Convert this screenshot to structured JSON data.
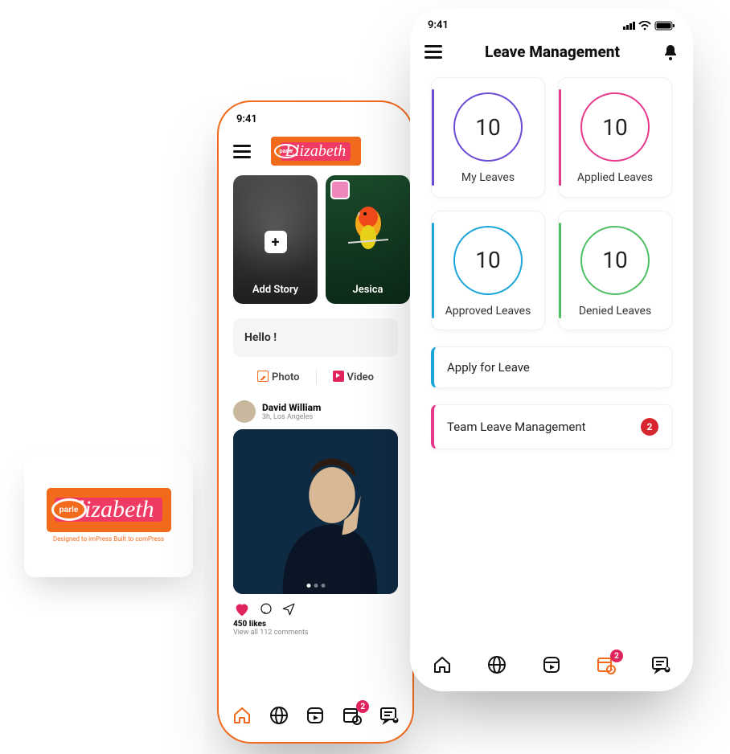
{
  "logo": {
    "brand_oval": "parle",
    "brand_script": "Elizabeth",
    "tagline": "Designed to imPress    Built to comPress"
  },
  "phone1": {
    "status_time": "9:41",
    "topbar": {
      "brand_oval": "parle",
      "brand_script": "Elizabeth"
    },
    "stories": {
      "add_label": "Add Story",
      "story1_name": "Jesica"
    },
    "compose": {
      "placeholder": "Hello !",
      "photo_label": "Photo",
      "video_label": "Video"
    },
    "post": {
      "author": "David William",
      "subline": "3h, Los Angeles",
      "likes_line": "450 likes",
      "comments_line": "View all 112 comments"
    },
    "nav_badge": "2"
  },
  "phone2": {
    "status_time": "9:41",
    "title": "Leave Management",
    "cards": [
      {
        "value": "10",
        "label": "My Leaves",
        "ring": "#6b4bd6",
        "accent": "#6b4bd6"
      },
      {
        "value": "10",
        "label": "Applied Leaves",
        "ring": "#e83a8c",
        "accent": "#e83a8c"
      },
      {
        "value": "10",
        "label": "Approved Leaves",
        "ring": "#1aa6d9",
        "accent": "#1aa6d9"
      },
      {
        "value": "10",
        "label": "Denied Leaves",
        "ring": "#4fbf63",
        "accent": "#4fbf63"
      }
    ],
    "actions": [
      {
        "label": "Apply for Leave",
        "accent": "#1aa6d9",
        "badge": null
      },
      {
        "label": "Team Leave Management",
        "accent": "#e83a8c",
        "badge": "2"
      }
    ],
    "nav_badge": "2"
  }
}
